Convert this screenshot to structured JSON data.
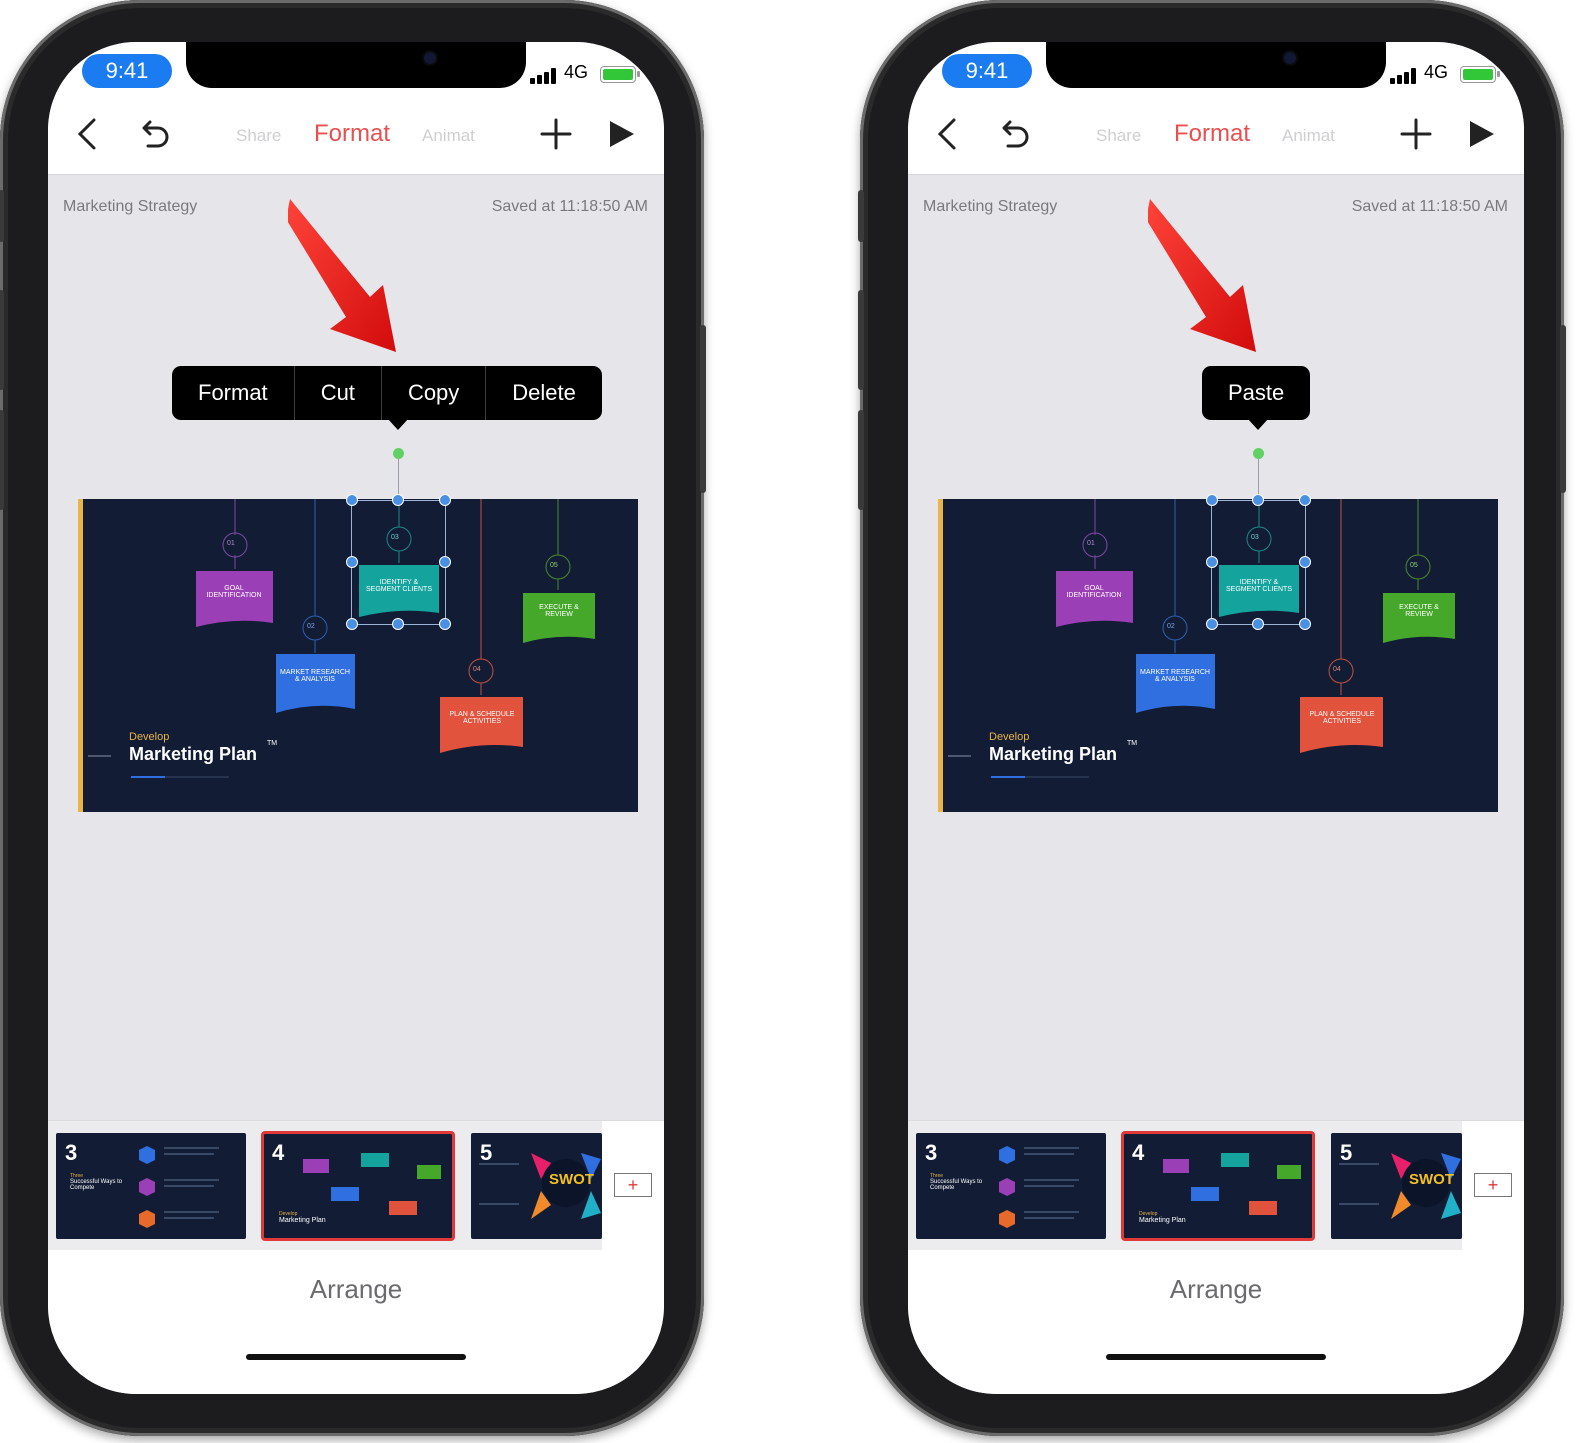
{
  "phones": [
    {
      "status": {
        "time": "9:41",
        "network": "4G"
      },
      "toolbar": {
        "tab_share": "Share",
        "tab_format": "Format",
        "tab_animate": "Animat"
      },
      "document": {
        "title": "Marketing Strategy",
        "saved": "Saved at 11:18:50 AM"
      },
      "context_menu": [
        "Format",
        "Cut",
        "Copy",
        "Delete"
      ],
      "slide": {
        "develop": "Develop",
        "title": "Marketing Plan",
        "tm": "TM",
        "steps": [
          {
            "num": "01",
            "label": "GOAL IDENTIFICATION"
          },
          {
            "num": "02",
            "label": "MARKET RESEARCH & ANALYSIS"
          },
          {
            "num": "03",
            "label": "IDENTIFY & SEGMENT CLIENTS"
          },
          {
            "num": "04",
            "label": "PLAN & SCHEDULE ACTIVITIES"
          },
          {
            "num": "05",
            "label": "EXECUTE & REVIEW"
          }
        ]
      },
      "thumbnails": [
        {
          "num": "3",
          "title": "Successful Ways to Compete",
          "pre": "Three"
        },
        {
          "num": "4",
          "title": "Marketing Plan",
          "pre": "Develop"
        },
        {
          "num": "5",
          "title": "SWOT",
          "pre": ""
        }
      ],
      "add_label": "+",
      "arrange": "Arrange"
    },
    {
      "status": {
        "time": "9:41",
        "network": "4G"
      },
      "toolbar": {
        "tab_share": "Share",
        "tab_format": "Format",
        "tab_animate": "Animat"
      },
      "document": {
        "title": "Marketing Strategy",
        "saved": "Saved at 11:18:50 AM"
      },
      "context_menu": [
        "Paste"
      ],
      "slide": {
        "develop": "Develop",
        "title": "Marketing Plan",
        "tm": "TM",
        "steps": [
          {
            "num": "01",
            "label": "GOAL IDENTIFICATION"
          },
          {
            "num": "02",
            "label": "MARKET RESEARCH & ANALYSIS"
          },
          {
            "num": "03",
            "label": "IDENTIFY & SEGMENT CLIENTS"
          },
          {
            "num": "04",
            "label": "PLAN & SCHEDULE ACTIVITIES"
          },
          {
            "num": "05",
            "label": "EXECUTE & REVIEW"
          }
        ]
      },
      "thumbnails": [
        {
          "num": "3",
          "title": "Successful Ways to Compete",
          "pre": "Three"
        },
        {
          "num": "4",
          "title": "Marketing Plan",
          "pre": "Develop"
        },
        {
          "num": "5",
          "title": "SWOT",
          "pre": ""
        }
      ],
      "add_label": "+",
      "arrange": "Arrange"
    }
  ],
  "colors": {
    "accent": "#e85050",
    "status_pill": "#1a7cf0",
    "slide_bg": "#121c35",
    "step_goal": "#9b3fb7",
    "step_market": "#2f6fe0",
    "step_identify": "#14a39d",
    "step_plan": "#e1533d",
    "step_execute": "#46a82a",
    "selection": "#4a90e2"
  }
}
